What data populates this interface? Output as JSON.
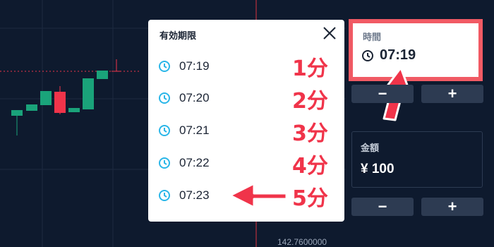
{
  "chart": {
    "price_label": "142.7600000"
  },
  "expiry_popup": {
    "title": "有効期限",
    "items": [
      {
        "time": "07:19",
        "annotation": "1分"
      },
      {
        "time": "07:20",
        "annotation": "2分"
      },
      {
        "time": "07:21",
        "annotation": "3分"
      },
      {
        "time": "07:22",
        "annotation": "4分"
      },
      {
        "time": "07:23",
        "annotation": "5分"
      }
    ]
  },
  "time_panel": {
    "label": "時間",
    "value": "07:19",
    "minus_label": "−",
    "plus_label": "+"
  },
  "amount_panel": {
    "label": "金額",
    "value": "¥ 100",
    "minus_label": "−",
    "plus_label": "+"
  },
  "colors": {
    "background": "#0e1a2e",
    "bull_candle": "#1aa37a",
    "bear_candle": "#f0344a",
    "accent_clock": "#2ab6e8",
    "highlight": "#f15a64"
  }
}
